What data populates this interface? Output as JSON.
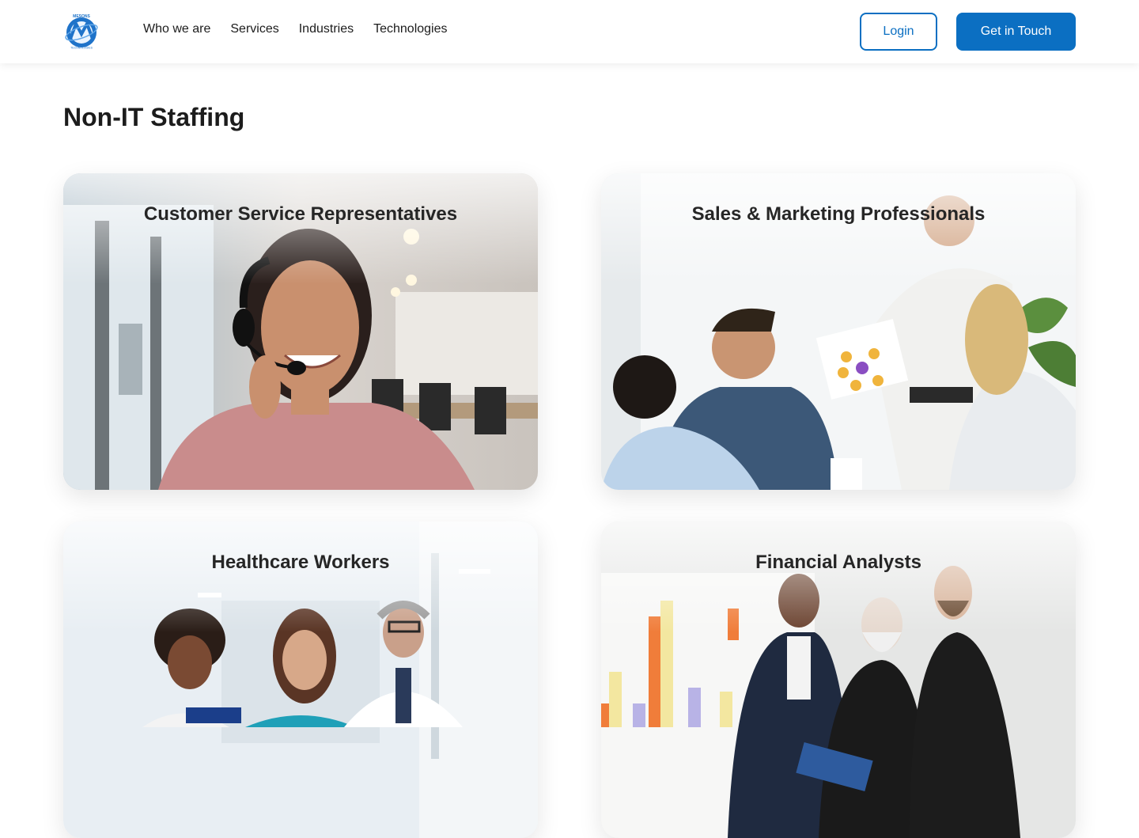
{
  "header": {
    "logo_text": "MESONS TECHNOLOGIES",
    "nav": [
      "Who we are",
      "Services",
      "Industries",
      "Technologies"
    ],
    "login_label": "Login",
    "contact_label": "Get in Touch"
  },
  "page": {
    "title": "Non-IT Staffing"
  },
  "cards": [
    {
      "title": "Customer Service Representatives"
    },
    {
      "title": "Sales & Marketing Professionals"
    },
    {
      "title": "Healthcare Workers"
    },
    {
      "title": "Financial Analysts"
    }
  ],
  "colors": {
    "primary": "#0b6fc2"
  }
}
